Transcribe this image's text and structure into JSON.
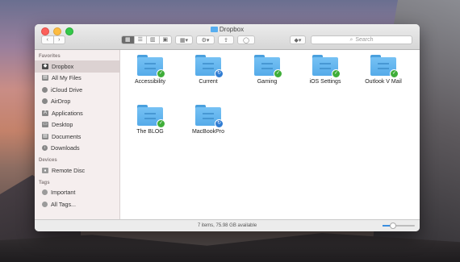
{
  "window": {
    "title": "Dropbox"
  },
  "toolbar": {
    "back_label": "‹",
    "forward_label": "›",
    "view_icon": "view-icon-grid",
    "arrange_label": "▦▾",
    "action_label": "⚙▾",
    "share_label": "⇪",
    "tags_label": "◯",
    "dropbox_label": "◆▾",
    "search_placeholder": "Search"
  },
  "sidebar": {
    "favorites_header": "Favorites",
    "favorites": [
      {
        "label": "Dropbox",
        "icon": "dropbox-icon",
        "selected": true
      },
      {
        "label": "All My Files",
        "icon": "all-files-icon"
      },
      {
        "label": "iCloud Drive",
        "icon": "cloud-icon"
      },
      {
        "label": "AirDrop",
        "icon": "airdrop-icon"
      },
      {
        "label": "Applications",
        "icon": "applications-icon"
      },
      {
        "label": "Desktop",
        "icon": "desktop-icon"
      },
      {
        "label": "Documents",
        "icon": "documents-icon"
      },
      {
        "label": "Downloads",
        "icon": "downloads-icon"
      }
    ],
    "devices_header": "Devices",
    "devices": [
      {
        "label": "Remote Disc",
        "icon": "disc-icon"
      }
    ],
    "tags_header": "Tags",
    "tags": [
      {
        "label": "Important",
        "icon": "tag-icon"
      },
      {
        "label": "All Tags...",
        "icon": "tag-icon"
      }
    ]
  },
  "files": [
    {
      "name": "Accessibility",
      "status": "synced"
    },
    {
      "name": "Current",
      "status": "syncing"
    },
    {
      "name": "Gaming",
      "status": "synced"
    },
    {
      "name": "iOS Settings",
      "status": "synced"
    },
    {
      "name": "Outlook V Mail",
      "status": "synced"
    },
    {
      "name": "The BLOG",
      "status": "synced"
    },
    {
      "name": "MacBookPro",
      "status": "syncing"
    }
  ],
  "status": {
    "text": "7 items, 75.98 GB available",
    "icon_size_fraction": 0.3
  },
  "colors": {
    "accent": "#3b8fe0",
    "synced": "#3fae39",
    "syncing": "#2f7cd3",
    "folder": "#5fb3ee"
  }
}
